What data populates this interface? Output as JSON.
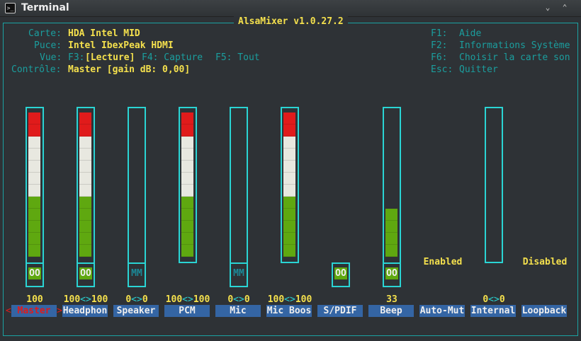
{
  "window": {
    "title": "Terminal",
    "minimize": "⌄",
    "maximize": "⌃"
  },
  "app_title": "AlsaMixer v1.0.27.2",
  "info": {
    "card_label": "Carte:",
    "card": "HDA Intel MID",
    "chip_label": "Puce:",
    "chip": "Intel IbexPeak HDMI",
    "view_label": "Vue:",
    "view_f3": "F3:",
    "view_current": "[Lecture]",
    "view_f4": "F4: Capture",
    "view_f5": "F5: Tout",
    "control_label": "Contrôle:",
    "control": "Master [gain dB: 0,00]"
  },
  "help": [
    {
      "key": "F1:",
      "text": "Aide"
    },
    {
      "key": "F2:",
      "text": "Informations Système"
    },
    {
      "key": "F6:",
      "text": "Choisir la carte son"
    },
    {
      "key": "Esc:",
      "text": "Quitter"
    }
  ],
  "colors": {
    "red": "#e01b1b",
    "white": "#e8e8e0",
    "green": "#5fa810",
    "cyan": "#2ad4d4",
    "label_bg": "#3465a4"
  },
  "controls": [
    {
      "name": "Master",
      "volume": 100,
      "value_left": "100",
      "value_right": null,
      "has_bar": true,
      "mute": "OO",
      "selected": true,
      "sel_left": "<",
      "sel_right": ">"
    },
    {
      "name": "Headphon",
      "volume": 100,
      "value_left": "100",
      "value_right": "100",
      "has_bar": true,
      "mute": "OO"
    },
    {
      "name": "Speaker",
      "volume": 0,
      "value_left": "0",
      "value_right": "0",
      "has_bar": true,
      "mute": "MM"
    },
    {
      "name": "PCM",
      "volume": 100,
      "value_left": "100",
      "value_right": "100",
      "has_bar": true,
      "mute": null
    },
    {
      "name": "Mic",
      "volume": 0,
      "value_left": "0",
      "value_right": "0",
      "has_bar": true,
      "mute": "MM"
    },
    {
      "name": "Mic Boos",
      "volume": 100,
      "value_left": "100",
      "value_right": "100",
      "has_bar": true,
      "mute": null
    },
    {
      "name": "S/PDIF",
      "volume": null,
      "value_left": null,
      "value_right": null,
      "has_bar": false,
      "mute": "OO"
    },
    {
      "name": "Beep",
      "volume": 33,
      "value_left": "33",
      "value_right": null,
      "has_bar": true,
      "mute": "OO"
    },
    {
      "name": "Auto-Mut",
      "volume": null,
      "value_left": null,
      "value_right": null,
      "has_bar": false,
      "mute": null,
      "switch": "Enabled"
    },
    {
      "name": "Internal",
      "volume": 0,
      "value_left": "0",
      "value_right": "0",
      "has_bar": true,
      "mute": null
    },
    {
      "name": "Loopback",
      "volume": null,
      "value_left": null,
      "value_right": null,
      "has_bar": false,
      "mute": null,
      "switch": "Disabled"
    }
  ],
  "value_separator": "<>"
}
